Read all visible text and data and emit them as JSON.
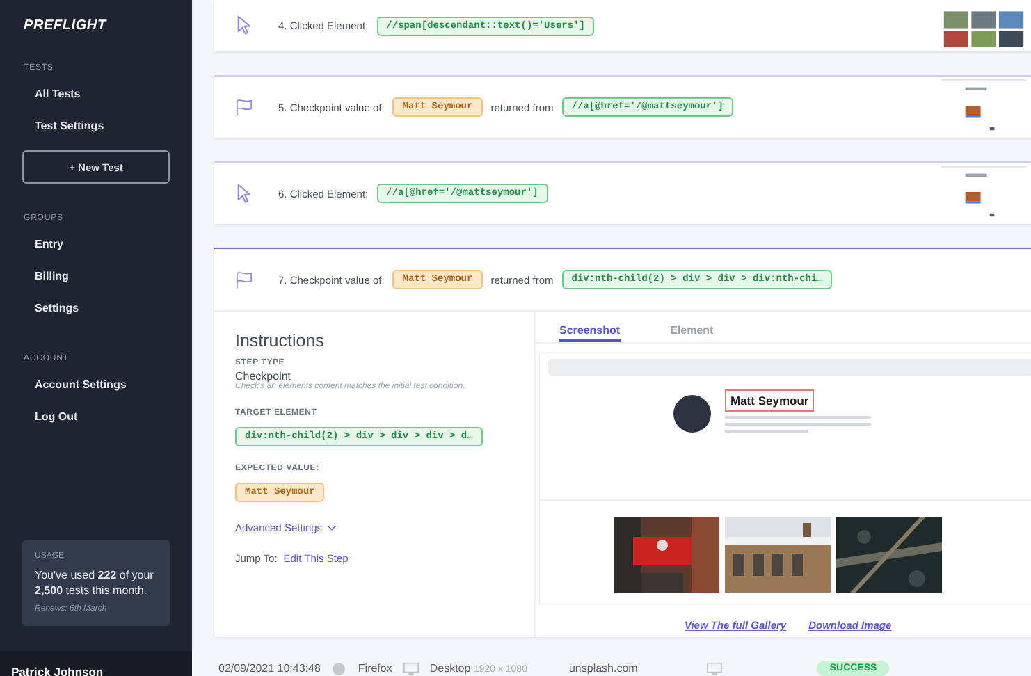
{
  "sidebar": {
    "logo": "PREFLIGHT",
    "sections": [
      {
        "heading": "TESTS",
        "items": [
          "All Tests",
          "Test Settings"
        ],
        "button": "+ New Test"
      },
      {
        "heading": "GROUPS",
        "items": [
          "Entry",
          "Billing",
          "Settings"
        ]
      },
      {
        "heading": "ACCOUNT",
        "items": [
          "Account Settings",
          "Log Out"
        ]
      }
    ],
    "usage": {
      "heading": "USAGE",
      "text": "You've used **222** of your **2,500** tests this month.",
      "renews": "Renews: 6th March"
    },
    "user": "Patrick Johnson"
  },
  "steps": [
    {
      "kind": "click",
      "label": "4. Clicked Element:",
      "selector": "//span[descendant::text()='Users']",
      "expanded": false
    },
    {
      "kind": "checkpoint",
      "label": "5. Checkpoint value of:",
      "value": "Matt Seymour",
      "connector": "returned from",
      "selector": "//a[@href='/@mattseymour']",
      "expanded": false
    },
    {
      "kind": "click",
      "label": "6. Clicked Element:",
      "selector": "//a[@href='/@mattseymour']",
      "expanded": false
    },
    {
      "kind": "checkpoint",
      "label": "7. Checkpoint value of:",
      "value": "Matt Seymour",
      "connector": "returned from",
      "selector": "div:nth-child(2) > div > div > div:nth-chi…",
      "expanded": true
    }
  ],
  "instructions": {
    "title": "Instructions",
    "step_type_label": "STEP TYPE",
    "step_type": "Checkpoint",
    "description": "Check's an elements content matches the initial test condition.",
    "target_label": "TARGET ELEMENT",
    "target": "div:nth-child(2) > div > div > div > d…",
    "expected_label": "EXPECTED VALUE:",
    "expected": "Matt Seymour",
    "advanced": "Advanced Settings",
    "jump_label": "Jump To:",
    "jump_link": "Edit This Step"
  },
  "viewer": {
    "tabs": [
      {
        "label": "Screenshot",
        "selected": true
      },
      {
        "label": "Element",
        "selected": false
      }
    ],
    "screenshot": {
      "heading": "Matt Seymour",
      "highlighted": true
    },
    "links": [
      "View The full Gallery",
      "Download Image"
    ]
  },
  "run": {
    "timestamp": "02/09/2021 10:43:48",
    "browser": "Firefox",
    "device": "Desktop",
    "resolution": "1920 x 1080",
    "domain": "unsplash.com",
    "status": "SUCCESS"
  }
}
